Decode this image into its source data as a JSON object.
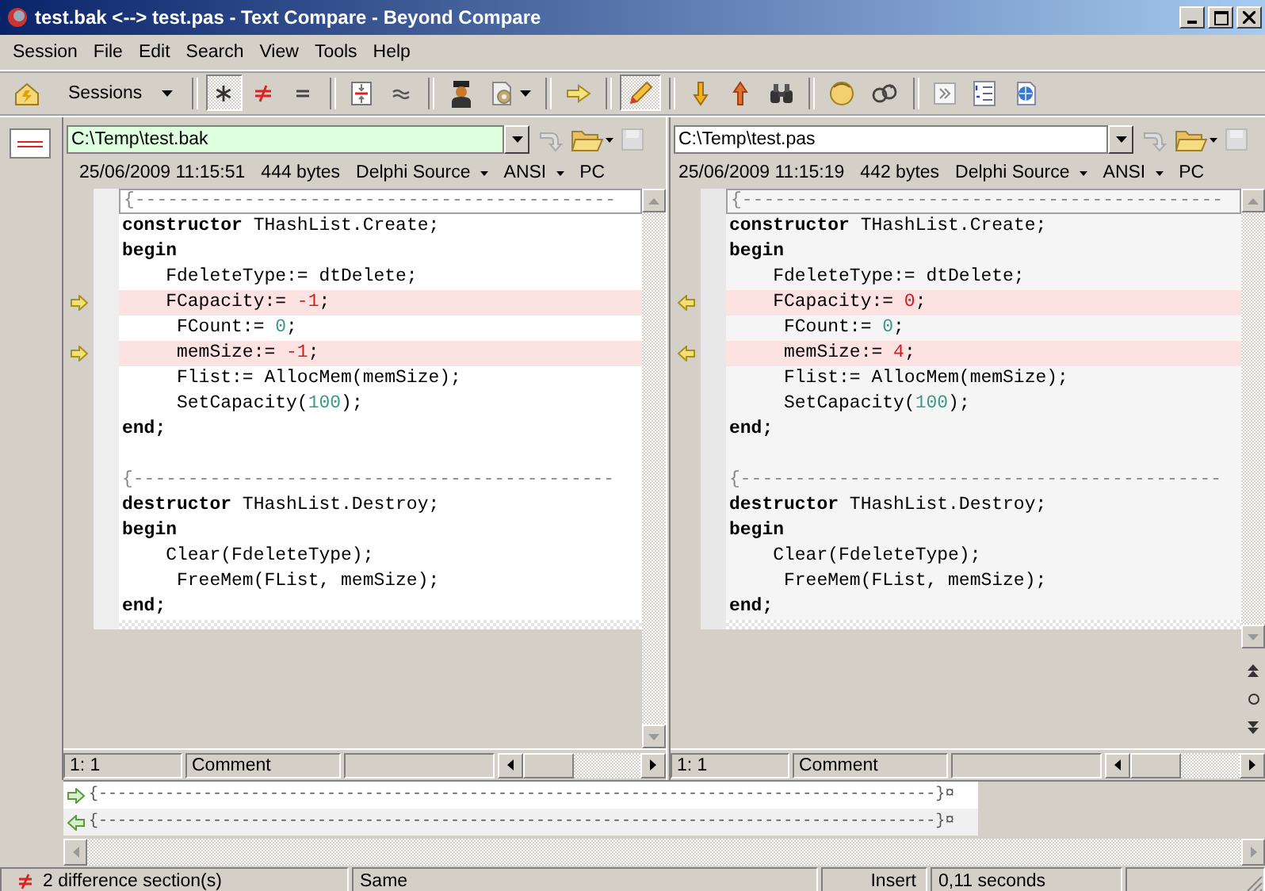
{
  "window": {
    "title": "test.bak <--> test.pas - Text Compare - Beyond Compare"
  },
  "menu": [
    "Session",
    "File",
    "Edit",
    "Search",
    "View",
    "Tools",
    "Help"
  ],
  "toolbar": [
    {
      "kind": "home"
    },
    {
      "kind": "sessions",
      "label": "Sessions"
    },
    {
      "kind": "sep"
    },
    {
      "kind": "star",
      "pressed": true
    },
    {
      "kind": "not-equal",
      "pressed": false
    },
    {
      "kind": "equal",
      "pressed": false
    },
    {
      "kind": "sep"
    },
    {
      "kind": "diff-lines",
      "pressed": false
    },
    {
      "kind": "approx",
      "pressed": false
    },
    {
      "kind": "sep"
    },
    {
      "kind": "person"
    },
    {
      "kind": "gear-doc"
    },
    {
      "kind": "sep"
    },
    {
      "kind": "arrow-right"
    },
    {
      "kind": "sep"
    },
    {
      "kind": "pencil",
      "pressed": true
    },
    {
      "kind": "sep"
    },
    {
      "kind": "arrow-down"
    },
    {
      "kind": "arrow-up"
    },
    {
      "kind": "binoculars"
    },
    {
      "kind": "sep"
    },
    {
      "kind": "head"
    },
    {
      "kind": "swap"
    },
    {
      "kind": "sep"
    },
    {
      "kind": "chevrons"
    },
    {
      "kind": "list"
    },
    {
      "kind": "globe-doc"
    }
  ],
  "panes": [
    {
      "path": "C:\\Temp\\test.bak",
      "focused": true,
      "date": "25/06/2009 11:15:51",
      "size": "444 bytes",
      "format": "Delphi Source",
      "encoding": "ANSI",
      "line_end": "PC",
      "position": "1: 1",
      "context": "Comment",
      "lines": [
        {
          "kind": "comment",
          "text": "{--------------------------------------------",
          "current": true,
          "diff": false
        },
        {
          "kind": "code",
          "tokens": [
            {
              "kind": "keyword",
              "text": "constructor"
            },
            {
              "kind": "plain",
              "text": " THashList.Create;"
            }
          ],
          "current": false,
          "diff": false
        },
        {
          "kind": "code",
          "tokens": [
            {
              "kind": "keyword",
              "text": "begin"
            }
          ],
          "current": false,
          "diff": false
        },
        {
          "kind": "code",
          "tokens": [
            {
              "kind": "plain",
              "text": "    FdeleteType:= dtDelete;"
            }
          ],
          "current": false,
          "diff": false
        },
        {
          "kind": "code",
          "tokens": [
            {
              "kind": "plain",
              "text": "    FCapacity:= "
            },
            {
              "kind": "changed",
              "text": "-1"
            },
            {
              "kind": "plain",
              "text": ";"
            }
          ],
          "current": false,
          "diff": true
        },
        {
          "kind": "code",
          "tokens": [
            {
              "kind": "plain",
              "text": "     FCount:= "
            },
            {
              "kind": "number",
              "text": "0"
            },
            {
              "kind": "plain",
              "text": ";"
            }
          ],
          "current": false,
          "diff": false
        },
        {
          "kind": "code",
          "tokens": [
            {
              "kind": "plain",
              "text": "     memSize:= "
            },
            {
              "kind": "changed",
              "text": "-1"
            },
            {
              "kind": "plain",
              "text": ";"
            }
          ],
          "current": false,
          "diff": true
        },
        {
          "kind": "code",
          "tokens": [
            {
              "kind": "plain",
              "text": "     Flist:= AllocMem(memSize);"
            }
          ],
          "current": false,
          "diff": false
        },
        {
          "kind": "code",
          "tokens": [
            {
              "kind": "plain",
              "text": "     SetCapacity("
            },
            {
              "kind": "number",
              "text": "100"
            },
            {
              "kind": "plain",
              "text": ");"
            }
          ],
          "current": false,
          "diff": false
        },
        {
          "kind": "code",
          "tokens": [
            {
              "kind": "keyword",
              "text": "end;"
            }
          ],
          "current": false,
          "diff": false
        },
        {
          "kind": "blank",
          "current": false,
          "diff": false
        },
        {
          "kind": "comment",
          "text": "{--------------------------------------------",
          "current": false,
          "diff": false
        },
        {
          "kind": "code",
          "tokens": [
            {
              "kind": "keyword",
              "text": "destructor"
            },
            {
              "kind": "plain",
              "text": " THashList.Destroy;"
            }
          ],
          "current": false,
          "diff": false
        },
        {
          "kind": "code",
          "tokens": [
            {
              "kind": "keyword",
              "text": "begin"
            }
          ],
          "current": false,
          "diff": false
        },
        {
          "kind": "code",
          "tokens": [
            {
              "kind": "plain",
              "text": "    Clear(FdeleteType);"
            }
          ],
          "current": false,
          "diff": false
        },
        {
          "kind": "code",
          "tokens": [
            {
              "kind": "plain",
              "text": "     FreeMem(FList, memSize);"
            }
          ],
          "current": false,
          "diff": false
        },
        {
          "kind": "code",
          "tokens": [
            {
              "kind": "keyword",
              "text": "end;"
            }
          ],
          "current": false,
          "diff": false
        }
      ]
    },
    {
      "path": "C:\\Temp\\test.pas",
      "focused": false,
      "date": "25/06/2009 11:15:19",
      "size": "442 bytes",
      "format": "Delphi Source",
      "encoding": "ANSI",
      "line_end": "PC",
      "position": "1: 1",
      "context": "Comment",
      "lines": [
        {
          "kind": "comment",
          "text": "{--------------------------------------------",
          "current": true,
          "diff": false
        },
        {
          "kind": "code",
          "tokens": [
            {
              "kind": "keyword",
              "text": "constructor"
            },
            {
              "kind": "plain",
              "text": " THashList.Create;"
            }
          ],
          "current": false,
          "diff": false
        },
        {
          "kind": "code",
          "tokens": [
            {
              "kind": "keyword",
              "text": "begin"
            }
          ],
          "current": false,
          "diff": false
        },
        {
          "kind": "code",
          "tokens": [
            {
              "kind": "plain",
              "text": "    FdeleteType:= dtDelete;"
            }
          ],
          "current": false,
          "diff": false
        },
        {
          "kind": "code",
          "tokens": [
            {
              "kind": "plain",
              "text": "    FCapacity:= "
            },
            {
              "kind": "changed",
              "text": "0"
            },
            {
              "kind": "plain",
              "text": ";"
            }
          ],
          "current": false,
          "diff": true
        },
        {
          "kind": "code",
          "tokens": [
            {
              "kind": "plain",
              "text": "     FCount:= "
            },
            {
              "kind": "number",
              "text": "0"
            },
            {
              "kind": "plain",
              "text": ";"
            }
          ],
          "current": false,
          "diff": false
        },
        {
          "kind": "code",
          "tokens": [
            {
              "kind": "plain",
              "text": "     memSize:= "
            },
            {
              "kind": "changed",
              "text": "4"
            },
            {
              "kind": "plain",
              "text": ";"
            }
          ],
          "current": false,
          "diff": true
        },
        {
          "kind": "code",
          "tokens": [
            {
              "kind": "plain",
              "text": "     Flist:= AllocMem(memSize);"
            }
          ],
          "current": false,
          "diff": false
        },
        {
          "kind": "code",
          "tokens": [
            {
              "kind": "plain",
              "text": "     SetCapacity("
            },
            {
              "kind": "number",
              "text": "100"
            },
            {
              "kind": "plain",
              "text": ");"
            }
          ],
          "current": false,
          "diff": false
        },
        {
          "kind": "code",
          "tokens": [
            {
              "kind": "keyword",
              "text": "end;"
            }
          ],
          "current": false,
          "diff": false
        },
        {
          "kind": "blank",
          "current": false,
          "diff": false
        },
        {
          "kind": "comment",
          "text": "{--------------------------------------------",
          "current": false,
          "diff": false
        },
        {
          "kind": "code",
          "tokens": [
            {
              "kind": "keyword",
              "text": "destructor"
            },
            {
              "kind": "plain",
              "text": " THashList.Destroy;"
            }
          ],
          "current": false,
          "diff": false
        },
        {
          "kind": "code",
          "tokens": [
            {
              "kind": "keyword",
              "text": "begin"
            }
          ],
          "current": false,
          "diff": false
        },
        {
          "kind": "code",
          "tokens": [
            {
              "kind": "plain",
              "text": "    Clear(FdeleteType);"
            }
          ],
          "current": false,
          "diff": false
        },
        {
          "kind": "code",
          "tokens": [
            {
              "kind": "plain",
              "text": "     FreeMem(FList, memSize);"
            }
          ],
          "current": false,
          "diff": false
        },
        {
          "kind": "code",
          "tokens": [
            {
              "kind": "keyword",
              "text": "end;"
            }
          ],
          "current": false,
          "diff": false
        }
      ]
    }
  ],
  "compare": [
    {
      "kind": "right",
      "text": "{----------------------------------------------------------------------------------------}¤"
    },
    {
      "kind": "left",
      "text": "{----------------------------------------------------------------------------------------}¤"
    }
  ],
  "status_bar": {
    "differences": "2 difference section(s)",
    "state": "Same",
    "mode": "Insert",
    "time": "0,11 seconds"
  }
}
